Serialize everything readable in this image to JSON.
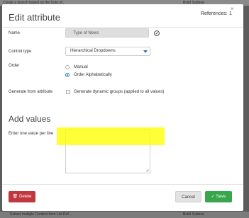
{
  "background": {
    "top_left_text": "Create a branch based on the Date of..",
    "top_right_text": "Build Subtree",
    "bottom_left_text": "Extract multiple Content from List Ref...",
    "bottom_right_text": "Build Subtree"
  },
  "modal": {
    "title": "Edit attribute",
    "references_label": "References:",
    "references_count": "1",
    "close_glyph": "×"
  },
  "form": {
    "name_label": "Name",
    "name_value": "Type of News",
    "control_type_label": "Control type",
    "control_type_value": "Hierarchical Dropdowns",
    "order_label": "Order",
    "order_options": [
      "Manual",
      "Order Alphabetically"
    ],
    "order_selected": "Order Alphabetically",
    "generate_label": "Generate from attribute",
    "generate_checkbox_label": "Generate dynamic groups (applied to all values)"
  },
  "values_section": {
    "title": "Add values",
    "textarea_label": "Enter one value per line"
  },
  "footer": {
    "delete_label": "Delete",
    "cancel_label": "Cancel",
    "save_label": "Save"
  },
  "colors": {
    "accent": "#2a7ab8",
    "delete": "#c0373f",
    "save": "#38a64a",
    "highlight": "#ffff00"
  }
}
